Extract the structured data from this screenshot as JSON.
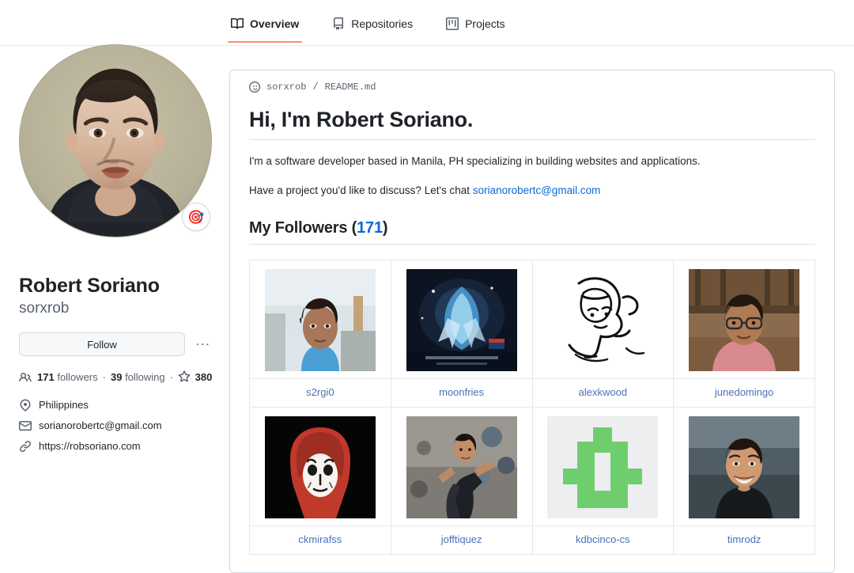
{
  "nav": {
    "tabs": [
      {
        "label": "Overview",
        "icon": "book-open-icon",
        "active": true
      },
      {
        "label": "Repositories",
        "icon": "repo-icon",
        "active": false
      },
      {
        "label": "Projects",
        "icon": "project-icon",
        "active": false
      }
    ],
    "active_underline_color": "#fd8c73"
  },
  "profile": {
    "avatar_alt": "avatar-painting-portrait",
    "status_emoji": "🎯",
    "fullname": "Robert Soriano",
    "username": "sorxrob",
    "follow_label": "Follow",
    "more_label": "...",
    "stats": {
      "followers_count": "171",
      "followers_label": "followers",
      "following_count": "39",
      "following_label": "following",
      "stars_count": "380",
      "separator": "·"
    },
    "meta": [
      {
        "icon": "location-icon",
        "text": "Philippines"
      },
      {
        "icon": "mail-icon",
        "text": "sorianorobertc@gmail.com"
      },
      {
        "icon": "link-icon",
        "text": "https://robsoriano.com"
      }
    ]
  },
  "readme": {
    "breadcrumb_icon": "smiley-icon",
    "breadcrumb_user": "sorxrob",
    "breadcrumb_separator": "/",
    "breadcrumb_file": "README.md",
    "heading": "Hi, I'm Robert Soriano.",
    "paragraph1": "I'm a software developer based in Manila, PH specializing in building websites and applications.",
    "paragraph2_prefix": "Have a project you'd like to discuss? Let's chat ",
    "paragraph2_email": "sorianorobertc@gmail.com",
    "followers_heading": "My Followers",
    "followers_open_paren": "(",
    "followers_count": "171",
    "followers_close_paren": ")"
  },
  "followers": [
    {
      "name": "s2rgi0",
      "thumb": "photo-man-blue-shirt-indoor"
    },
    {
      "name": "moonfries",
      "thumb": "artwork-blue-character-dark"
    },
    {
      "name": "alexkwood",
      "thumb": "ink-drawing-portrait-bw"
    },
    {
      "name": "junedomingo",
      "thumb": "photo-man-pink-shirt-glasses"
    },
    {
      "name": "ckmirafss",
      "thumb": "dali-mask-red-hood-dark"
    },
    {
      "name": "jofftiquez",
      "thumb": "photo-man-climbing-wall"
    },
    {
      "name": "kdbcinco-cs",
      "thumb": "green-pixel-logo"
    },
    {
      "name": "timrodz",
      "thumb": "photo-man-smiling-dark-shirt"
    }
  ],
  "colors": {
    "link": "#0969da",
    "follower_link": "#4a72b8",
    "muted": "#59636e",
    "border": "#d1d9e0"
  }
}
